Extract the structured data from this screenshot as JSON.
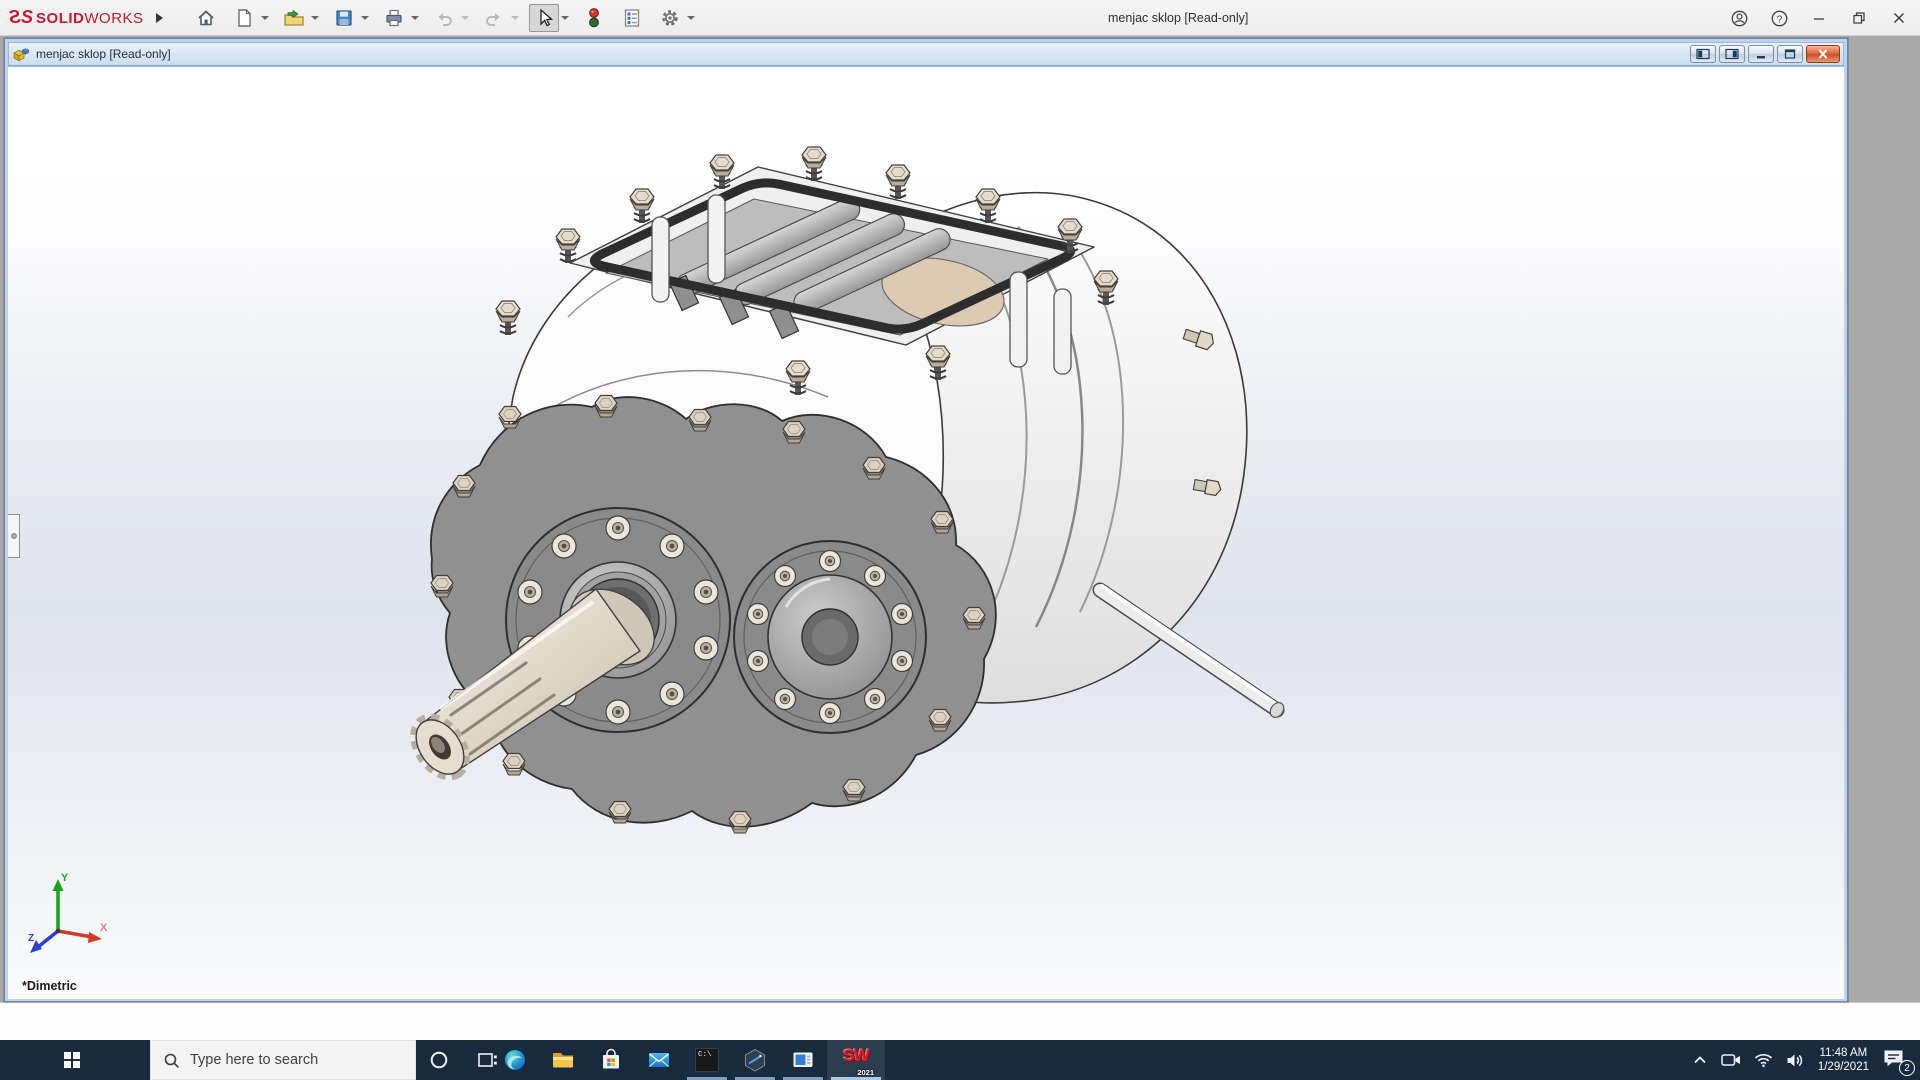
{
  "app": {
    "brand": {
      "mark": "S",
      "word_bold": "SOLID",
      "word_light": "WORKS"
    },
    "title": "menjac sklop [Read-only]",
    "toolbar_items": [
      "home",
      "new-document",
      "open",
      "save",
      "print",
      "undo",
      "redo",
      "select",
      "rebuild",
      "file-properties",
      "options"
    ],
    "window_controls": [
      "account",
      "help",
      "minimize",
      "restore",
      "close"
    ],
    "help_glyph": "?"
  },
  "document": {
    "title": "menjac sklop [Read-only]",
    "window_controls": [
      "pane-left",
      "pane-right",
      "minimize",
      "restore",
      "close"
    ],
    "view_label": "*Dimetric"
  },
  "viewport": {
    "triad": {
      "x": "X",
      "y": "Y",
      "z": "Z"
    }
  },
  "taskbar": {
    "search_placeholder": "Type here to search",
    "apps": [
      "edge",
      "file-explorer",
      "store",
      "mail",
      "command-prompt",
      "hexagon-app",
      "media-app",
      "solidworks-2021"
    ],
    "cmd_glyph": "C:\\",
    "sw_mark": "SW",
    "sw_year": "2021",
    "tray_items": [
      "tray-expand",
      "meet-now",
      "wifi",
      "volume",
      "clock",
      "action-center"
    ],
    "clock": {
      "time": "11:48 AM",
      "date": "1/29/2021"
    },
    "notification_badge": "2"
  },
  "colors": {
    "brand_red": "#c41932",
    "taskbar_bg": "#182a3d",
    "aero_border": "#bcd4ee",
    "mdi_background": "#a9a9a9",
    "viewport_mid": "#dfe3ed",
    "underline_open": "#7e9fc0",
    "underline_active": "#a9c9e8",
    "triad_x": "#d23b2f",
    "triad_y": "#19a319",
    "triad_z": "#2b3fd0"
  }
}
